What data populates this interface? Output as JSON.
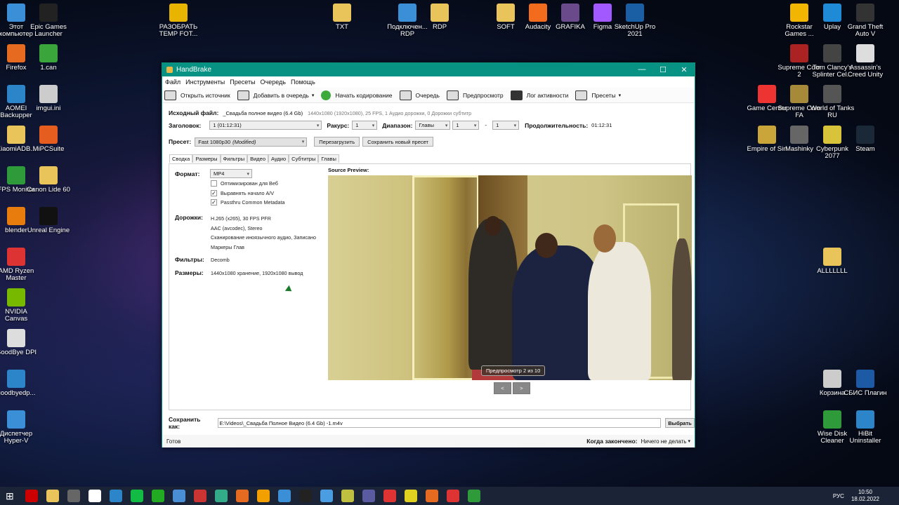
{
  "desktop_icons_left": [
    {
      "label": "Этот компьютер",
      "icon": "computer-icon",
      "color": "#3b8fd6"
    },
    {
      "label": "Firefox",
      "icon": "firefox-icon",
      "color": "#e66a20"
    },
    {
      "label": "AOMEI Backupper",
      "icon": "aomei-icon",
      "color": "#2d85c9"
    },
    {
      "label": "XiaomiADB...",
      "icon": "folder-icon",
      "color": "#e9c45a"
    },
    {
      "label": "FPS Monitor",
      "icon": "fps-monitor-icon",
      "color": "#2e9a3a"
    },
    {
      "label": "blender",
      "icon": "blender-icon",
      "color": "#e87d0d"
    },
    {
      "label": "AMD Ryzen Master",
      "icon": "amd-icon",
      "color": "#d33"
    },
    {
      "label": "NVIDIA Canvas",
      "icon": "nvidia-icon",
      "color": "#76b900"
    },
    {
      "label": "GoodBye DPI",
      "icon": "file-icon",
      "color": "#ddd"
    },
    {
      "label": "goodbyedp...",
      "icon": "refresh-icon",
      "color": "#2d85c9"
    },
    {
      "label": "Диспетчер Hyper-V",
      "icon": "hyperv-icon",
      "color": "#3b8fd6"
    }
  ],
  "desktop_icons_col2": [
    {
      "label": "Epic Games Launcher",
      "icon": "epic-icon",
      "color": "#222"
    },
    {
      "label": "1.can",
      "icon": "can-file-icon",
      "color": "#3aa53a"
    },
    {
      "label": "imgui.ini",
      "icon": "ini-file-icon",
      "color": "#ccc"
    },
    {
      "label": "MiPCSuite",
      "icon": "mi-icon",
      "color": "#e55d1f"
    },
    {
      "label": "Canon Lide 60",
      "icon": "folder-icon",
      "color": "#e9c45a"
    },
    {
      "label": "Unreal Engine",
      "icon": "unreal-icon",
      "color": "#111"
    }
  ],
  "desktop_icons_top": [
    {
      "label": "РАЗОБРАТЬ TEMP FOT...",
      "icon": "warning-icon",
      "color": "#e8b400"
    },
    {
      "label": "TXT",
      "icon": "folder-icon",
      "color": "#e9c45a"
    },
    {
      "label": "Подключен... RDP",
      "icon": "rdp-icon",
      "color": "#3b8fd6"
    },
    {
      "label": "RDP",
      "icon": "rdp-folder-icon",
      "color": "#e9c45a"
    },
    {
      "label": "SOFT",
      "icon": "soft-folder-icon",
      "color": "#e9c45a"
    },
    {
      "label": "Audacity",
      "icon": "audacity-icon",
      "color": "#f36b1c"
    },
    {
      "label": "GRAFIKA",
      "icon": "grafika-icon",
      "color": "#6a4a8a"
    },
    {
      "label": "Figma",
      "icon": "figma-icon",
      "color": "#a259ff"
    },
    {
      "label": "SketchUp Pro 2021",
      "icon": "sketchup-icon",
      "color": "#1a5fa3"
    }
  ],
  "desktop_icons_right": [
    {
      "label": "Rockstar Games ...",
      "icon": "rockstar-icon",
      "color": "#f2b600"
    },
    {
      "label": "Uplay",
      "icon": "uplay-icon",
      "color": "#1f8bd6"
    },
    {
      "label": "Grand Theft Auto V",
      "icon": "gta-icon",
      "color": "#333"
    },
    {
      "label": "Supreme Com 2",
      "icon": "supcom-icon",
      "color": "#a22"
    },
    {
      "label": "Tom Clancy's Splinter Cel...",
      "icon": "splinter-icon",
      "color": "#444"
    },
    {
      "label": "Assassin's Creed Unity",
      "icon": "ac-icon",
      "color": "#ddd"
    },
    {
      "label": "Game Center",
      "icon": "game-center-icon",
      "color": "#e33"
    },
    {
      "label": "Supreme Com FA",
      "icon": "supcom-fa-icon",
      "color": "#a68a3a"
    },
    {
      "label": "World of Tanks RU",
      "icon": "wot-icon",
      "color": "#555"
    },
    {
      "label": "Empire of Sin",
      "icon": "empire-icon",
      "color": "#c9a53a"
    },
    {
      "label": "Mashinky",
      "icon": "mashinky-icon",
      "color": "#666"
    },
    {
      "label": "Cyberpunk 2077",
      "icon": "cyberpunk-icon",
      "color": "#d8c43a"
    },
    {
      "label": "Steam",
      "icon": "steam-icon",
      "color": "#1b2838"
    },
    {
      "label": "ALLLLLLL",
      "icon": "folder-icon",
      "color": "#e9c45a"
    },
    {
      "label": "Корзина",
      "icon": "trash-icon",
      "color": "#ccc"
    },
    {
      "label": "СБИС Плагин",
      "icon": "sbis-icon",
      "color": "#1d5aa6"
    },
    {
      "label": "Wise Disk Cleaner",
      "icon": "wise-icon",
      "color": "#2e9a3a"
    },
    {
      "label": "HiBit Uninstaller",
      "icon": "hibit-icon",
      "color": "#2d85c9"
    }
  ],
  "window": {
    "title": "HandBrake",
    "menu": [
      "Файл",
      "Инструменты",
      "Пресеты",
      "Очередь",
      "Помощь"
    ],
    "toolbar": {
      "open_source": "Открыть источник",
      "add_queue": "Добавить в очередь",
      "start": "Начать кодирование",
      "queue": "Очередь",
      "preview": "Предпросмотр",
      "activity": "Лог активности",
      "presets": "Пресеты"
    },
    "source_label": "Исходный файл:",
    "source_value": "_Свадьба полное видео (6.4 Gb)",
    "source_info": "1440x1080 (1920x1080), 25 FPS, 1 Аудио дорожки, 0 Дорожки субтитр",
    "title_label": "Заголовок:",
    "title_value": "1 (01:12:31)",
    "angle_label": "Ракурс:",
    "angle_value": "1",
    "range_label": "Диапазон:",
    "range_type": "Главы",
    "range_from": "1",
    "range_dash": "-",
    "range_to": "1",
    "duration_label": "Продолжительность:",
    "duration_value": "01:12:31",
    "preset_label": "Пресет:",
    "preset_value": "Fast 1080p30",
    "preset_modified": "(Modified)",
    "reload_button": "Перезагрузить",
    "save_preset_button": "Сохранить новый пресет",
    "tabs": [
      "Сводка",
      "Размеры",
      "Фильтры",
      "Видео",
      "Аудио",
      "Субтитры",
      "Главы"
    ],
    "summary": {
      "format_label": "Формат:",
      "format_value": "MP4",
      "opt_web": "Оптимизирован для Веб",
      "align_av": "Выравнять начало A/V",
      "passthru": "Passthru Common Metadata",
      "tracks_label": "Дорожки:",
      "tracks": [
        "H.265 (x265), 30 FPS PFR",
        "AAC (avcodec), Stereo",
        "Сканирование иноязычного аудио, Записано",
        "Маркеры Глав"
      ],
      "filters_label": "Фильтры:",
      "filters_value": "Decomb",
      "sizes_label": "Размеры:",
      "sizes_value": "1440x1080 хранение, 1920x1080 вывод"
    },
    "preview": {
      "title": "Source Preview:",
      "badge": "Предпросмотр 2 из 10",
      "prev": "<",
      "next": ">"
    },
    "save_as_label": "Сохранить как:",
    "save_as_value": "E:\\Videos\\_Свадьба Полное Видео (6.4 Gb) -1.m4v",
    "browse_button": "Выбрать",
    "status": "Готов",
    "when_done_label": "Когда закончено:",
    "when_done_value": "Ничего не делать"
  },
  "taskbar": {
    "lang": "РУС",
    "time": "10:50",
    "date": "18.02.2022"
  }
}
